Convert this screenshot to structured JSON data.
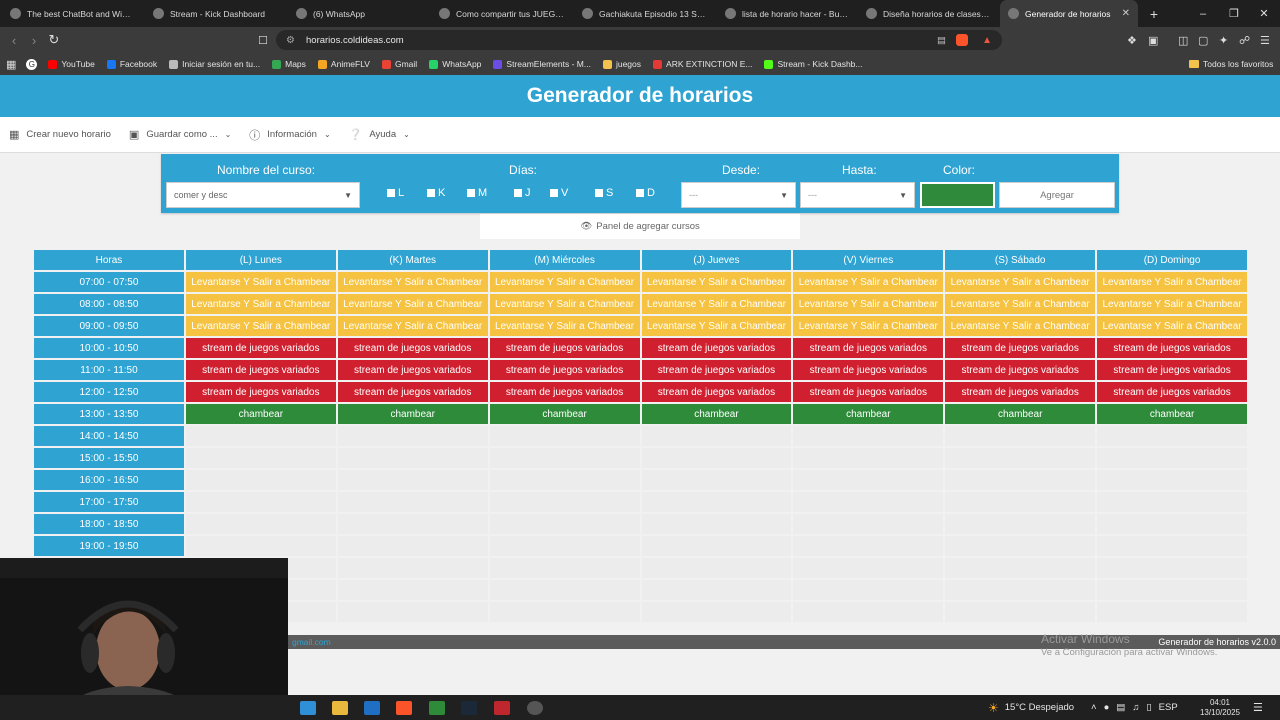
{
  "browser": {
    "tabs": [
      {
        "label": "The best ChatBot and Widgets",
        "icon": "chatbot-favicon"
      },
      {
        "label": "Stream - Kick Dashboard",
        "icon": "kick-favicon"
      },
      {
        "label": "(6) WhatsApp",
        "icon": "whatsapp-favicon"
      },
      {
        "label": "Como compartir tus JUEGOS e",
        "icon": "youtube-favicon"
      },
      {
        "label": "Gachiakuta Episodio 13 Sub Es",
        "icon": "animeflv-favicon"
      },
      {
        "label": "lista de horario hacer - Buscar",
        "icon": "google-favicon"
      },
      {
        "label": "Diseña horarios de clases grati",
        "icon": "edge-favicon"
      },
      {
        "label": "Generador de horarios",
        "icon": "google-favicon",
        "active": true
      }
    ],
    "url": "horarios.coldideas.com",
    "bookmarks": [
      {
        "label": "YouTube",
        "color": "#ff0000"
      },
      {
        "label": "Facebook",
        "color": "#1877f2"
      },
      {
        "label": "Iniciar sesión en tu...",
        "color": "#bbbbbb"
      },
      {
        "label": "Maps",
        "color": "#34a853"
      },
      {
        "label": "AnimeFLV",
        "color": "#f4a623"
      },
      {
        "label": "Gmail",
        "color": "#ea4335"
      },
      {
        "label": "WhatsApp",
        "color": "#25d366"
      },
      {
        "label": "StreamElements - M...",
        "color": "#6c4de6"
      },
      {
        "label": "juegos",
        "color": "#f2c14e"
      },
      {
        "label": "ARK EXTINCTION E...",
        "color": "#e53935"
      },
      {
        "label": "Stream - Kick Dashb...",
        "color": "#53fc18"
      }
    ],
    "all_favorites": "Todos los favoritos"
  },
  "app": {
    "title": "Generador de horarios",
    "menu": {
      "new": "Crear nuevo horario",
      "save": "Guardar como ...",
      "info": "Información",
      "help": "Ayuda"
    },
    "form": {
      "course_label": "Nombre del curso:",
      "course_value": "comer y desc",
      "days_label": "Días:",
      "days": [
        "L",
        "K",
        "M",
        "J",
        "V",
        "S",
        "D"
      ],
      "from_label": "Desde:",
      "from_value": "---",
      "to_label": "Hasta:",
      "to_value": "---",
      "color_label": "Color:",
      "color_value": "#2f8b3b",
      "add_button": "Agregar"
    },
    "panel_toggle": "Panel de agregar cursos",
    "schedule": {
      "headers": [
        "Horas",
        "(L) Lunes",
        "(K) Martes",
        "(M) Miércoles",
        "(J) Jueves",
        "(V) Viernes",
        "(S) Sábado",
        "(D) Domingo"
      ],
      "rows": [
        {
          "time": "07:00 - 07:50",
          "course": "Levantarse Y Salir a Chambear",
          "color": "#f5c242",
          "text_color": "#ffffff"
        },
        {
          "time": "08:00 - 08:50",
          "course": "Levantarse Y Salir a Chambear",
          "color": "#f5c242",
          "text_color": "#ffffff"
        },
        {
          "time": "09:00 - 09:50",
          "course": "Levantarse Y Salir a Chambear",
          "color": "#f5c242",
          "text_color": "#ffffff"
        },
        {
          "time": "10:00 - 10:50",
          "course": "stream de juegos variados",
          "color": "#d0202f",
          "text_color": "#ffffff"
        },
        {
          "time": "11:00 - 11:50",
          "course": "stream de juegos variados",
          "color": "#d0202f",
          "text_color": "#ffffff"
        },
        {
          "time": "12:00 - 12:50",
          "course": "stream de juegos variados",
          "color": "#d0202f",
          "text_color": "#ffffff"
        },
        {
          "time": "13:00 - 13:50",
          "course": "chambear",
          "color": "#2e8b3a",
          "text_color": "#ffffff"
        },
        {
          "time": "14:00 - 14:50",
          "course": "",
          "color": "#ececec"
        },
        {
          "time": "15:00 - 15:50",
          "course": "",
          "color": "#ececec"
        },
        {
          "time": "16:00 - 16:50",
          "course": "",
          "color": "#ececec"
        },
        {
          "time": "17:00 - 17:50",
          "course": "",
          "color": "#ececec"
        },
        {
          "time": "18:00 - 18:50",
          "course": "",
          "color": "#ececec"
        },
        {
          "time": "19:00 - 19:50",
          "course": "",
          "color": "#ececec"
        },
        {
          "time": "",
          "course": "",
          "color": "#ececec"
        },
        {
          "time": "",
          "course": "",
          "color": "#ececec"
        },
        {
          "time": "",
          "course": "",
          "color": "#ececec"
        }
      ]
    },
    "footer": {
      "email": "gmail.com",
      "version": "Generador de horarios v2.0.0"
    }
  },
  "windows": {
    "watermark_title": "Activar Windows",
    "watermark_sub": "Ve a Configuración para activar Windows.",
    "weather": "15°C  Despejado",
    "language": "ESP",
    "time": "04:01",
    "date": "13/10/2025"
  }
}
